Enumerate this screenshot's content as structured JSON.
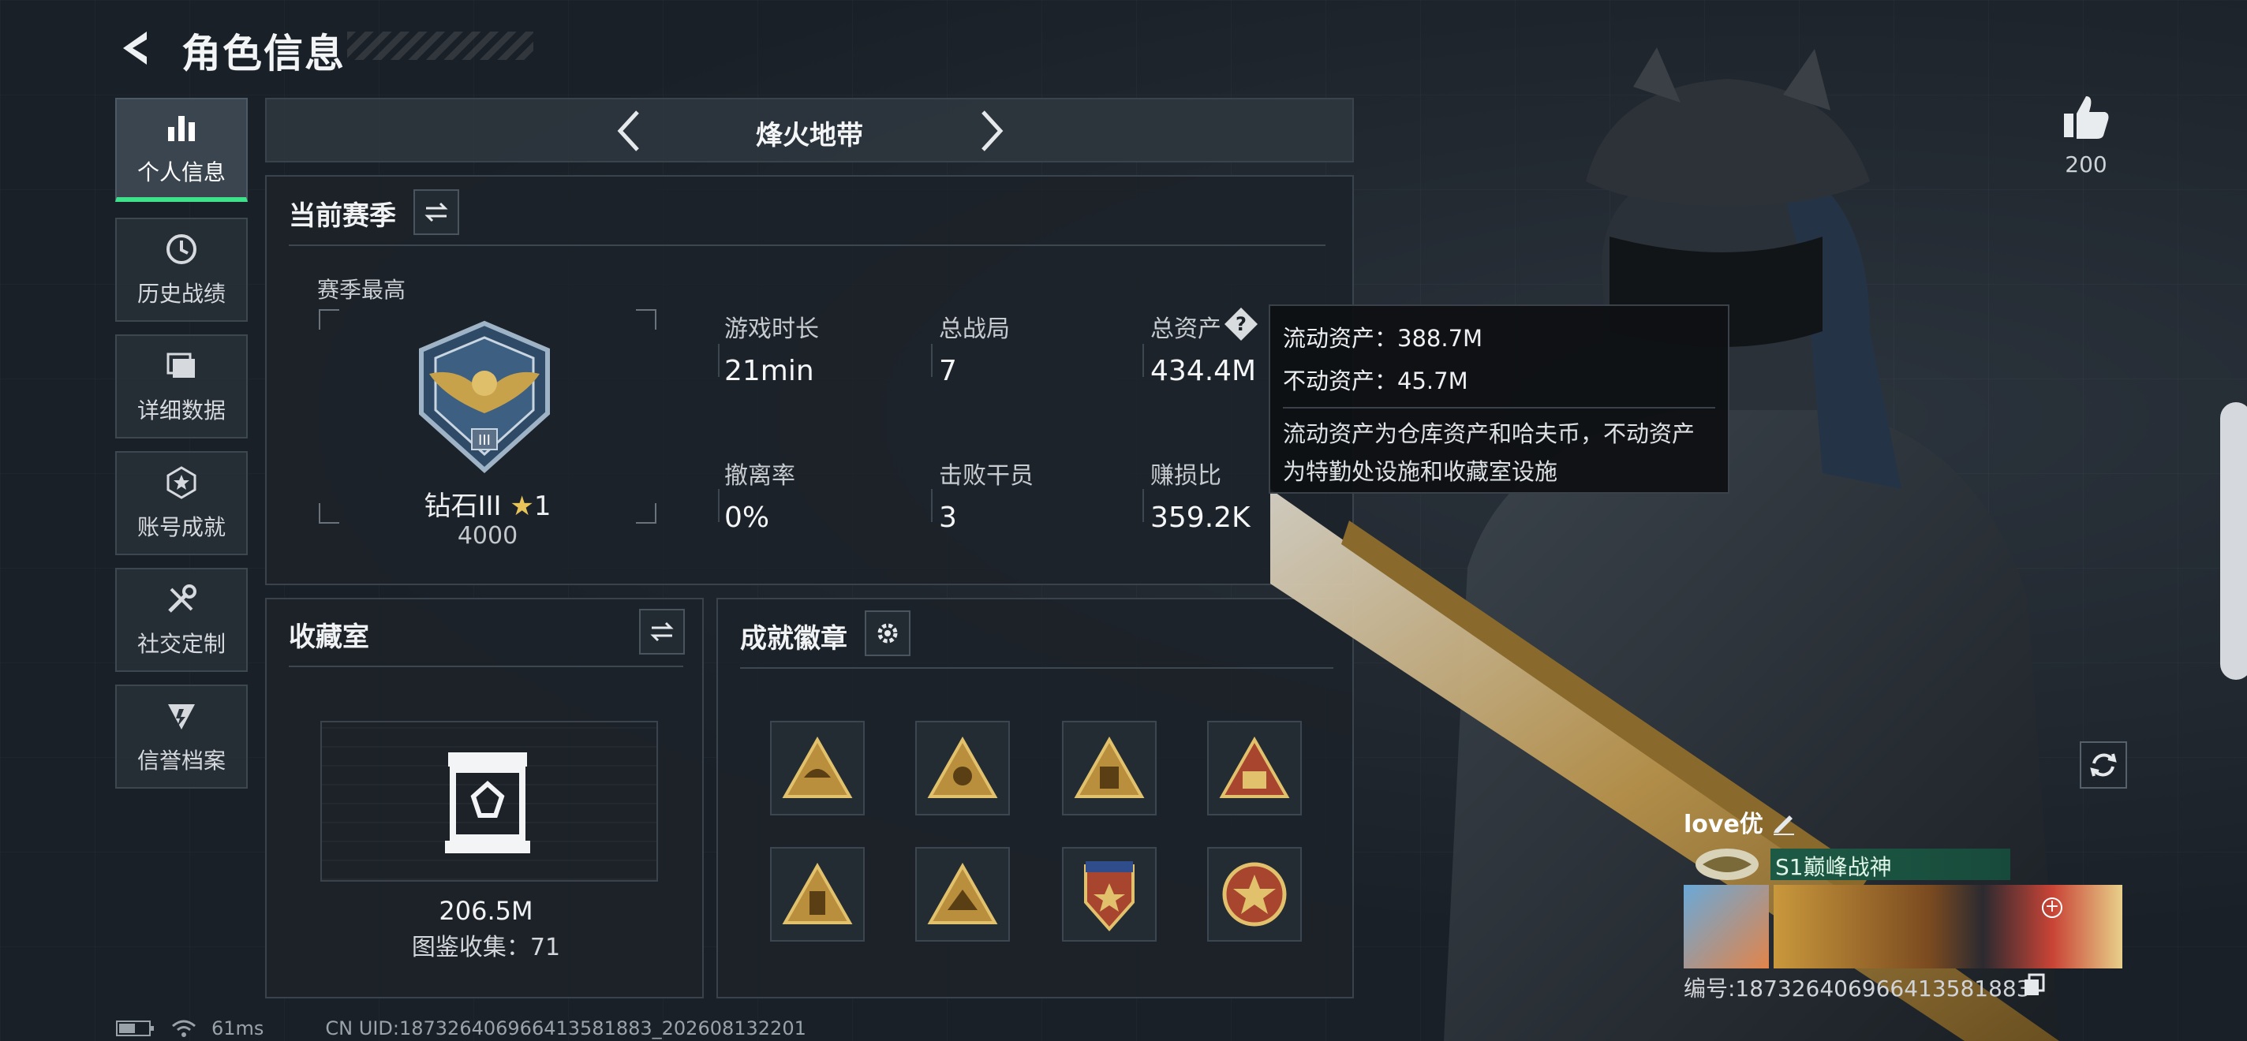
{
  "header": {
    "title": "角色信息"
  },
  "sidebar": {
    "items": [
      {
        "label": "个人信息",
        "icon": "bar-chart-icon",
        "active": true
      },
      {
        "label": "历史战绩",
        "icon": "history-clock-icon",
        "active": false
      },
      {
        "label": "详细数据",
        "icon": "folder-icon",
        "active": false
      },
      {
        "label": "账号成就",
        "icon": "achievement-icon",
        "active": false
      },
      {
        "label": "社交定制",
        "icon": "tools-icon",
        "active": false
      },
      {
        "label": "信誉档案",
        "icon": "shield-icon",
        "active": false
      }
    ]
  },
  "mode": {
    "label": "烽火地带"
  },
  "season": {
    "title": "当前赛季",
    "best_label": "赛季最高",
    "rank_name": "钻石III",
    "rank_stars": "1",
    "rank_points": "4000",
    "stats": [
      {
        "label": "游戏时长",
        "value": "21min"
      },
      {
        "label": "总战局",
        "value": "7"
      },
      {
        "label": "总资产",
        "value": "434.4M"
      },
      {
        "label": "撤离率",
        "value": "0%"
      },
      {
        "label": "击败干员",
        "value": "3"
      },
      {
        "label": "赚损比",
        "value": "359.2K"
      }
    ]
  },
  "tooltip": {
    "liquid": "流动资产：388.7M",
    "fixed": "不动资产：45.7M",
    "desc_line1": "流动资产为仓库资产和哈夫币，不动资产",
    "desc_line2": "为特勤处设施和收藏室设施"
  },
  "collection": {
    "title": "收藏室",
    "value": "206.5M",
    "count_text": "图鉴收集：71"
  },
  "badges": {
    "title": "成就徽章"
  },
  "player": {
    "likes": "200",
    "name": "love优",
    "title": "S1巅峰战神",
    "id_text": "编号:187326406966413581883"
  },
  "status": {
    "ping": "61ms",
    "uid": "CN UID:187326406966413581883_202608132201"
  },
  "colors": {
    "accent_green": "#3ee28a",
    "gold": "#c8a24a",
    "panel_border": "#3a434c"
  }
}
